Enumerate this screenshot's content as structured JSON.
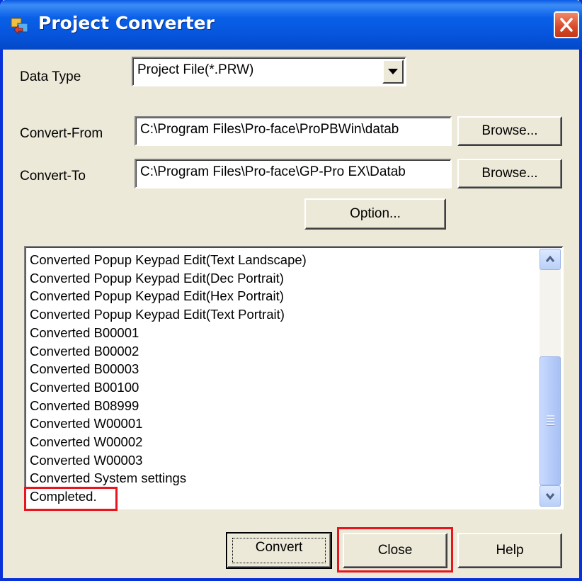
{
  "window": {
    "title": "Project Converter"
  },
  "colors": {
    "titlebar": "#0655dc",
    "highlight": "#e8141e",
    "face": "#ece9d8"
  },
  "icons": {
    "app": "converter-app-icon",
    "close": "close-icon"
  },
  "form": {
    "data_type_label": "Data Type",
    "data_type_value": "Project File(*.PRW)",
    "convert_from_label": "Convert-From",
    "convert_from_value": "C:\\Program Files\\Pro-face\\ProPBWin\\datab",
    "convert_to_label": "Convert-To",
    "convert_to_value": "C:\\Program Files\\Pro-face\\GP-Pro EX\\Datab",
    "browse_label": "Browse...",
    "option_label": "Option..."
  },
  "log": {
    "lines": [
      "Converted Popup Keypad Edit(Text Landscape)",
      "Converted Popup Keypad Edit(Dec Portrait)",
      "Converted Popup Keypad Edit(Hex Portrait)",
      "Converted Popup Keypad Edit(Text Portrait)",
      "Converted B00001",
      "Converted B00002",
      "Converted B00003",
      "Converted B00100",
      "Converted B08999",
      "Converted W00001",
      "Converted W00002",
      "Converted W00003",
      "Converted System settings",
      "Completed."
    ]
  },
  "buttons": {
    "convert": "Convert",
    "close": "Close",
    "help": "Help"
  }
}
